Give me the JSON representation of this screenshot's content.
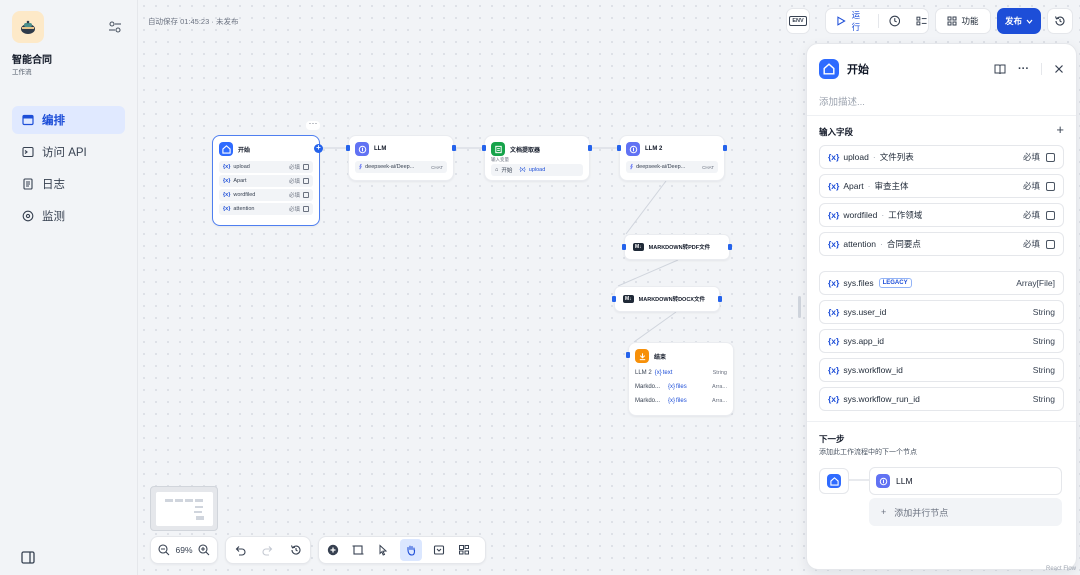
{
  "app": {
    "name": "智能合同",
    "type": "工作流"
  },
  "nav": [
    {
      "label": "编排",
      "icon": "layout-icon",
      "active": true
    },
    {
      "label": "访问 API",
      "icon": "terminal-icon",
      "active": false
    },
    {
      "label": "日志",
      "icon": "doc-icon",
      "active": false
    },
    {
      "label": "监测",
      "icon": "monitor-icon",
      "active": false
    }
  ],
  "autosave": "自动保存 01:45:23 · 未发布",
  "toolbar": {
    "env": "ENV",
    "run": "运行",
    "features": "功能",
    "publish": "发布"
  },
  "nodes": {
    "start": {
      "title": "开始",
      "vars": [
        {
          "name": "upload",
          "req": "必填"
        },
        {
          "name": "Apart",
          "req": "必填"
        },
        {
          "name": "wordfiled",
          "req": "必填"
        },
        {
          "name": "attention",
          "req": "必填"
        }
      ]
    },
    "llm1": {
      "title": "LLM",
      "model": "deepseek-ai/Deep...",
      "mode": "CHAT"
    },
    "doc": {
      "title": "文档提取器",
      "input_label": "输入变量",
      "src_node": "开始",
      "src_var": "upload"
    },
    "llm2": {
      "title": "LLM 2",
      "model": "deepseek-ai/Deep...",
      "mode": "CHAT"
    },
    "md_pdf": {
      "badge": "M↓",
      "title": "MARKDOWN转PDF文件"
    },
    "md_docx": {
      "badge": "M↓",
      "title": "MARKDOWN转DOCX文件"
    },
    "end": {
      "title": "结束",
      "rows": [
        {
          "src": "LLM 2",
          "var": "text",
          "type": "String"
        },
        {
          "src": "Markdo...",
          "var": "files",
          "type": "Arra..."
        },
        {
          "src": "Markdo...",
          "var": "files",
          "type": "Arra..."
        }
      ]
    }
  },
  "zoom": "69%",
  "panel": {
    "title": "开始",
    "desc_placeholder": "添加描述...",
    "input_label": "输入字段",
    "fields": [
      {
        "name": "upload",
        "label": "文件列表",
        "req": "必填"
      },
      {
        "name": "Apart",
        "label": "审查主体",
        "req": "必填"
      },
      {
        "name": "wordfiled",
        "label": "工作领域",
        "req": "必填"
      },
      {
        "name": "attention",
        "label": "合同要点",
        "req": "必填"
      }
    ],
    "sys_fields": [
      {
        "name": "sys.files",
        "legacy": "LEGACY",
        "type": "Array[File]"
      },
      {
        "name": "sys.user_id",
        "type": "String"
      },
      {
        "name": "sys.app_id",
        "type": "String"
      },
      {
        "name": "sys.workflow_id",
        "type": "String"
      },
      {
        "name": "sys.workflow_run_id",
        "type": "String"
      }
    ],
    "next_label": "下一步",
    "next_desc": "添加此工作流程中的下一个节点",
    "next_node": "LLM",
    "add_parallel": "添加并行节点"
  },
  "attribution": "React Flow",
  "colors": {
    "primary": "#1d4ed8",
    "accent_blue": "#2f6bff",
    "start_icon": "#2f6bff",
    "llm_icon": "#6172f3",
    "doc_icon": "#16a34a",
    "end_icon": "#f79009"
  }
}
